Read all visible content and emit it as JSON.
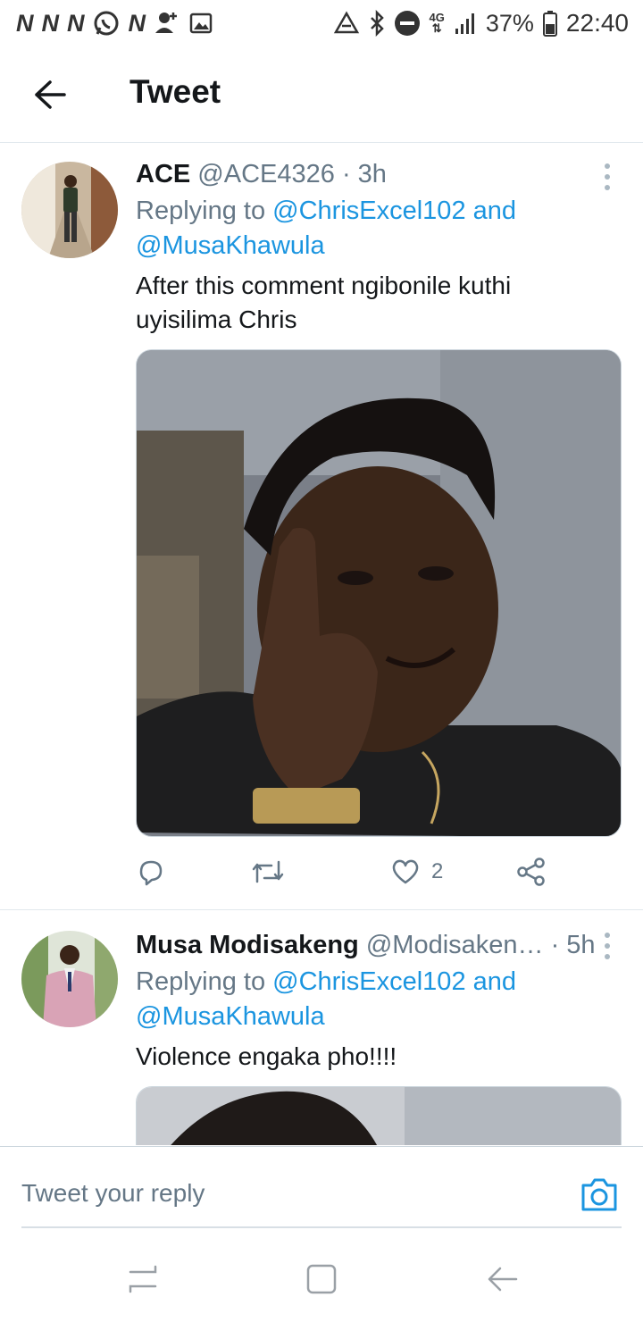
{
  "status_bar": {
    "notif_letters": [
      "N",
      "N",
      "N",
      "N"
    ],
    "network": "4G",
    "battery": "37%",
    "time": "22:40"
  },
  "header": {
    "title": "Tweet"
  },
  "tweets": [
    {
      "name": "ACE",
      "handle": "@ACE4326",
      "time": "· 3h",
      "replying_prefix": "Replying to",
      "mention1": "@ChrisExcel102",
      "and": "and",
      "mention2": "@MusaKhawula",
      "text": "After this comment ngibonile kuthi uyisilima Chris",
      "likes": "2"
    },
    {
      "name": "Musa Modisakeng",
      "handle": "@Modisaken…",
      "time": "· 5h",
      "replying_prefix": "Replying to",
      "mention1": "@ChrisExcel102",
      "and": "and",
      "mention2": "@MusaKhawula",
      "text": "Violence engaka pho!!!!"
    }
  ],
  "reply_bar": {
    "placeholder": "Tweet your reply"
  },
  "colors": {
    "link": "#1b95e0",
    "muted": "#657786",
    "divider": "#e1e8ed"
  }
}
